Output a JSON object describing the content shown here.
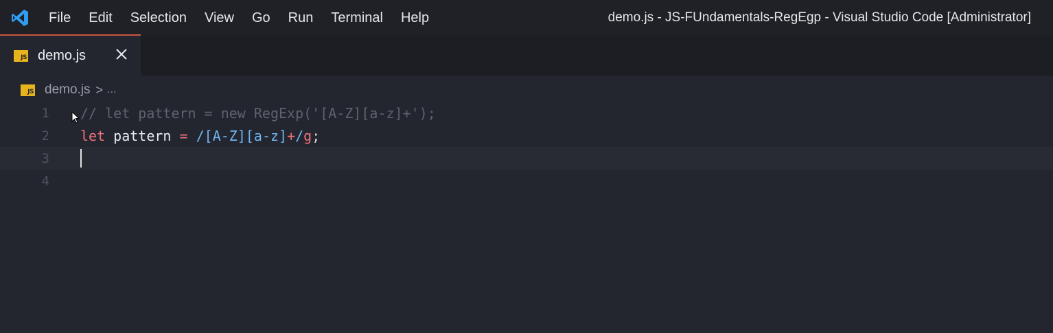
{
  "app": {
    "window_title": "demo.js - JS-FUndamentals-RegEgp - Visual Studio Code [Administrator]",
    "logo_icon": "vscode-logo-icon",
    "accent_color": "#c9573e"
  },
  "menu": {
    "items": [
      {
        "label": "File"
      },
      {
        "label": "Edit"
      },
      {
        "label": "Selection"
      },
      {
        "label": "View"
      },
      {
        "label": "Go"
      },
      {
        "label": "Run"
      },
      {
        "label": "Terminal"
      },
      {
        "label": "Help"
      }
    ]
  },
  "tabs": [
    {
      "label": "demo.js",
      "badge": "JS",
      "close_icon": "close-icon",
      "active": true
    }
  ],
  "breadcrumb": {
    "badge": "JS",
    "file": "demo.js",
    "separator": ">",
    "rest": "..."
  },
  "editor": {
    "lines": [
      {
        "number": "1",
        "tokens": [
          {
            "type": "comment",
            "text": "// let pattern = new RegExp('[A-Z][a-z]+');"
          }
        ]
      },
      {
        "number": "2",
        "tokens": [
          {
            "type": "kw",
            "text": "let"
          },
          {
            "type": "punc",
            "text": " "
          },
          {
            "type": "id",
            "text": "pattern"
          },
          {
            "type": "punc",
            "text": " "
          },
          {
            "type": "op",
            "text": "="
          },
          {
            "type": "punc",
            "text": " "
          },
          {
            "type": "re",
            "text": "/[A-Z][a-z]"
          },
          {
            "type": "op",
            "text": "+"
          },
          {
            "type": "re",
            "text": "/"
          },
          {
            "type": "flag",
            "text": "g"
          },
          {
            "type": "punc",
            "text": ";"
          }
        ]
      },
      {
        "number": "3",
        "tokens": [],
        "current": true
      },
      {
        "number": "4",
        "tokens": []
      }
    ]
  },
  "colors": {
    "background": "#23262e",
    "titlebar": "#1f2127",
    "js_badge": "#e8b41d",
    "keyword": "#f0727e",
    "regex": "#6fb6f2",
    "comment": "#5e636d"
  }
}
